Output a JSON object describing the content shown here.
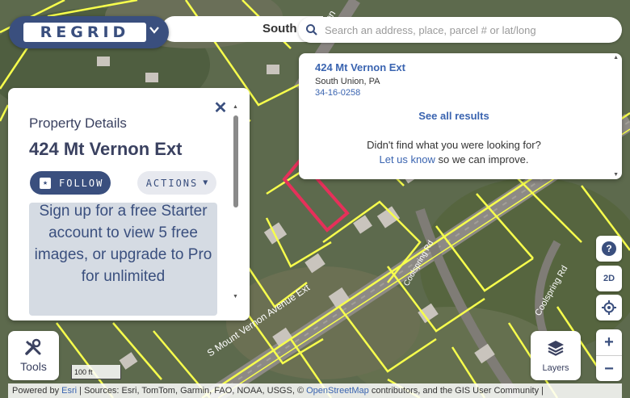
{
  "app": {
    "logo_text": "REGRID",
    "place_title": "South"
  },
  "search": {
    "placeholder": "Search an address, place, parcel # or lat/long"
  },
  "results": {
    "address": "424 Mt Vernon Ext",
    "city": "South Union, PA",
    "parcel": "34-16-0258",
    "see_all": "See all results",
    "not_found": "Didn't find what you were looking for?",
    "contact_link": "Let us know",
    "contact_rest": " so we can improve."
  },
  "panel": {
    "label": "Property Details",
    "title": "424 Mt Vernon Ext",
    "follow_label": "FOLLOW",
    "actions_label": "ACTIONS",
    "promo_text": "Sign up for a free Starter account to view 5 free images, or upgrade to Pro for unlimited"
  },
  "controls": {
    "help": "?",
    "view_mode": "2D",
    "zoom_in": "+",
    "zoom_out": "−",
    "tools_label": "Tools",
    "layers_label": "Layers"
  },
  "map": {
    "road_label_1": "S Mount Vernon Avenue Ext",
    "road_label_2": "Vernon",
    "road_label_3": "Coolspring Rd",
    "road_label_4": "Coolspring Rd",
    "scale_label": "100 ft",
    "parcel_color": "#f7ff4c",
    "highlight_color": "#e6305a"
  },
  "attribution": {
    "powered": "Powered by ",
    "esri": "Esri",
    "sources": " | Sources: Esri, TomTom, Garmin, FAO, NOAA, USGS, © ",
    "osm": "OpenStreetMap",
    "rest": " contributors, and the GIS User Community |"
  }
}
